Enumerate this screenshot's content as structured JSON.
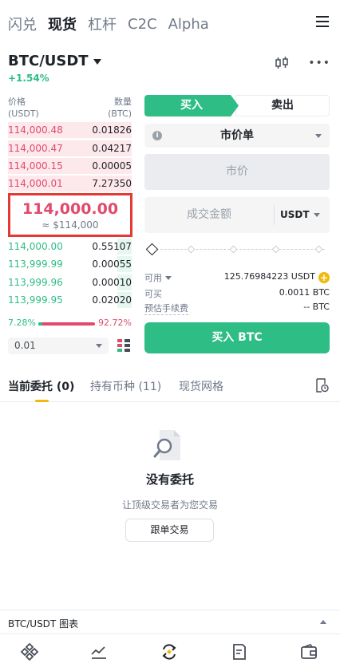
{
  "top_tabs": [
    "闪兑",
    "现货",
    "杠杆",
    "C2C",
    "Alpha"
  ],
  "pair": {
    "name": "BTC/USDT",
    "change": "+1.54%"
  },
  "orderbook": {
    "price_label": "价格",
    "price_unit": "(USDT)",
    "qty_label": "数量",
    "qty_unit": "(BTC)",
    "asks": [
      {
        "price": "114,000.48",
        "qty": "0.01826"
      },
      {
        "price": "114,000.47",
        "qty": "0.04217"
      },
      {
        "price": "114,000.15",
        "qty": "0.00005"
      },
      {
        "price": "114,000.01",
        "qty": "7.27350"
      }
    ],
    "mid_price": "114,000.00",
    "mid_usd": "≈ $114,000",
    "bids": [
      {
        "price": "114,000.00",
        "qty": "0.55107"
      },
      {
        "price": "113,999.99",
        "qty": "0.00055"
      },
      {
        "price": "113,999.96",
        "qty": "0.00010"
      },
      {
        "price": "113,999.95",
        "qty": "0.02020"
      }
    ],
    "buy_ratio": "7.28%",
    "sell_ratio": "92.72%",
    "buy_ratio_value": 7.28,
    "depth": "0.01"
  },
  "trade": {
    "buy_tab": "买入",
    "sell_tab": "卖出",
    "order_type": "市价单",
    "price_placeholder": "市价",
    "amount_placeholder": "成交金额",
    "amount_unit": "USDT",
    "available_label": "可用",
    "available_value": "125.76984223 USDT",
    "can_buy_label": "可买",
    "can_buy_value": "0.0011 BTC",
    "fee_label": "预估手续费",
    "fee_value": "-- BTC",
    "buy_button": "买入 BTC"
  },
  "bottom_tabs": {
    "open_orders": "当前委托 (0)",
    "holdings": "持有币种 (11)",
    "grid": "现货网格"
  },
  "empty": {
    "title": "没有委托",
    "subtitle": "让顶级交易者为您交易",
    "button": "跟单交易"
  },
  "chart_bar": "BTC/USDT 图表",
  "colors": {
    "green": "#2ebd85",
    "red": "#e04a6b",
    "yellow": "#f0b90b"
  },
  "nav": [
    "home-icon",
    "markets-icon",
    "trade-icon",
    "futures-icon",
    "wallet-icon"
  ]
}
